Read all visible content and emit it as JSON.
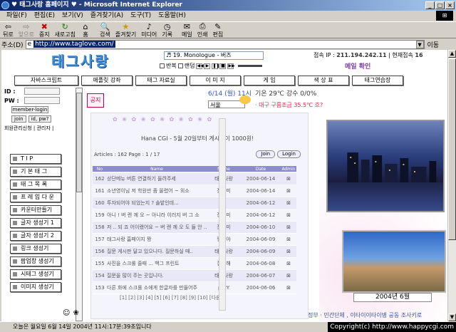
{
  "window": {
    "title": "♥ 태그사랑 홈페이지 ♥ - Microsoft Internet Explorer"
  },
  "menu": [
    "파일(F)",
    "편집(E)",
    "보기(V)",
    "즐겨찾기(A)",
    "도구(T)",
    "도움말(H)"
  ],
  "toolbar": [
    {
      "label": "뒤로",
      "icon": "back-icon",
      "disabled": false
    },
    {
      "label": "앞으로",
      "icon": "forward-icon",
      "disabled": true
    },
    {
      "label": "중지",
      "icon": "stop-icon",
      "disabled": false
    },
    {
      "label": "새로고침",
      "icon": "refresh-icon",
      "disabled": false
    },
    {
      "label": "홈",
      "icon": "home-icon",
      "disabled": false
    },
    {
      "label": "검색",
      "icon": "search-icon",
      "disabled": false
    },
    {
      "label": "즐겨찾기",
      "icon": "favorites-icon",
      "disabled": false
    },
    {
      "label": "미디어",
      "icon": "media-icon",
      "disabled": false
    },
    {
      "label": "기록",
      "icon": "history-icon",
      "disabled": false
    },
    {
      "label": "메일",
      "icon": "mail-icon",
      "disabled": false
    },
    {
      "label": "인쇄",
      "icon": "print-icon",
      "disabled": false
    },
    {
      "label": "편집",
      "icon": "edit-icon",
      "disabled": false
    }
  ],
  "address": {
    "label": "주소(D)",
    "url": "http://www.taglove.com/",
    "go": "이동"
  },
  "site": {
    "logo": "태그사랑",
    "music": "♬ 19. Monologue - 버즈",
    "player_options": [
      "반복",
      "랜덤"
    ],
    "ip_label": "접속 IP :",
    "ip": "211.194.242.11",
    "current_label": "현재접속",
    "current": "16",
    "mail": "메일 확인",
    "nav": [
      "자바스크립트",
      "애플릿 강좌",
      "태그 자료실",
      "이 미 지",
      "게 임",
      "색 상 표",
      "태그연습장"
    ],
    "login": {
      "id": "ID :",
      "pw": "PW :",
      "member_login": "member-login",
      "join": "join",
      "find": "id, pw?",
      "register_note": "회원관리신청 | 관리자 |"
    },
    "notice": "공지",
    "side_menu": [
      "T I P",
      "기 본 태 그",
      "태 그 목 록",
      "프 레 임 다 운",
      "카운터만들기",
      "글자 생성기 1",
      "글자 생성기 2",
      "링크 생성기",
      "팝업창 생성기",
      "시테그 생성기",
      "이미지 생성기"
    ],
    "date": "6/14 (월) 11시",
    "region": "서울",
    "weather_line1": "기온 29℃ 강수 0/0%",
    "weather_line2": "· 대구 구름조금 35.5℃ 흐?",
    "board": {
      "title": "Hana CGI - 5월 20일부터 게시판이 1000원!",
      "articles": "Articles : 162  Page : 1 / 17",
      "join_btn": "Join",
      "login_btn": "Login",
      "headers": [
        "No",
        "Name",
        "Name",
        "Date",
        "Admin"
      ],
      "rows": [
        {
          "no": "162",
          "title": "상단메뉴 버튼 연결하기 들려주세",
          "name": "태그사랑",
          "date": "2004-06-14"
        },
        {
          "no": "161",
          "title": "소년영이님 저 학원만 좀 올렸어 ~ 외소",
          "name": "장주미",
          "date": "2004-06-14"
        },
        {
          "no": "160",
          "title": "투자되어야 되었는지 ? 솔밭인데...",
          "name": "수",
          "date": "2004-06-12"
        },
        {
          "no": "159",
          "title": "아니 ! 버 렌 께 오 ~ 아니라 이러지 버 그 소",
          "name": "장주미",
          "date": "2004-06-12"
        },
        {
          "no": "158",
          "title": "저 .. 되 죠 어이랬어요 ~ 버 렌 께 오 도 들 안 ..",
          "name": "장주미",
          "date": "2004-06-10"
        },
        {
          "no": "157",
          "title": "태그사랑 홈페이지 짱",
          "name": "짱이야",
          "date": "2004-06-09"
        },
        {
          "no": "156",
          "title": "질문 게시판 달고 있으니다. 질문하실 때..",
          "name": "태그사랑",
          "date": "2004-06-09"
        },
        {
          "no": "155",
          "title": "사진을 스크롤 줄때 ... 백그 프린트",
          "name": "질문해",
          "date": "2004-06-08"
        },
        {
          "no": "154",
          "title": "질문을 많이 주는 곳입니다.",
          "name": "태그사랑",
          "date": "2004-06-07"
        },
        {
          "no": "153",
          "title": "다른 화에 스크롤 소에게 한글자를 만들어주",
          "name": "purY",
          "date": "2004-06-06"
        }
      ],
      "pages": "[1] [2] [3] [4] [5] [6] [7] [8] [9] [10] [다음]"
    },
    "photo_caption": "2004년 6월",
    "ticker": "정부 · 민간단체 , 이타이이타이병 공동 조사키로"
  },
  "status": {
    "text": "오늘은 월요일  6월 14일 2004년 11시:17분:39초입니다",
    "copyright": "Copyright(c) http://www.happycgi.com"
  }
}
